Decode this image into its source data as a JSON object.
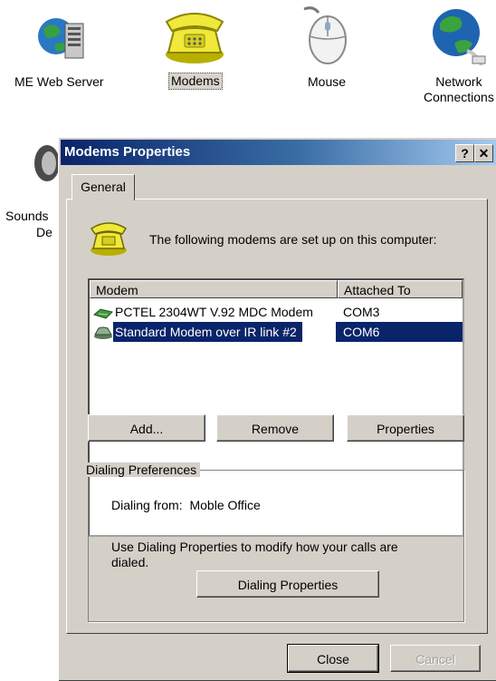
{
  "control_panel": {
    "items": [
      {
        "label": "ME Web Server",
        "icon": "web-server-icon"
      },
      {
        "label": "Modems",
        "icon": "modem-phone-icon",
        "selected": true
      },
      {
        "label": "Mouse",
        "icon": "mouse-icon"
      },
      {
        "label": "Network\nConnections",
        "icon": "network-globe-icon"
      },
      {
        "label": "Sounds",
        "icon": "speaker-icon"
      },
      {
        "label": "De",
        "icon": ""
      }
    ]
  },
  "dialog": {
    "title": "Modems Properties",
    "help_button": "?",
    "close_button": "✕",
    "tabs": [
      {
        "label": "General",
        "active": true
      }
    ],
    "intro_text": "The following modems are set up on this computer:",
    "modem_list": {
      "columns": [
        "Modem",
        "Attached To"
      ],
      "rows": [
        {
          "modem": "PCTEL 2304WT V.92 MDC Modem",
          "port": "COM3",
          "selected": false
        },
        {
          "modem": "Standard Modem over IR link #2",
          "port": "COM6",
          "selected": true
        }
      ]
    },
    "buttons": {
      "add": "Add...",
      "remove": "Remove",
      "properties": "Properties"
    },
    "dialing_preferences": {
      "legend": "Dialing Preferences",
      "dialing_from_label": "Dialing from:",
      "dialing_from_value": "Moble Office",
      "help_text": "Use Dialing Properties to modify how your calls are dialed.",
      "dialing_properties_button": "Dialing Properties"
    },
    "footer": {
      "close": "Close",
      "cancel": "Cancel"
    }
  }
}
